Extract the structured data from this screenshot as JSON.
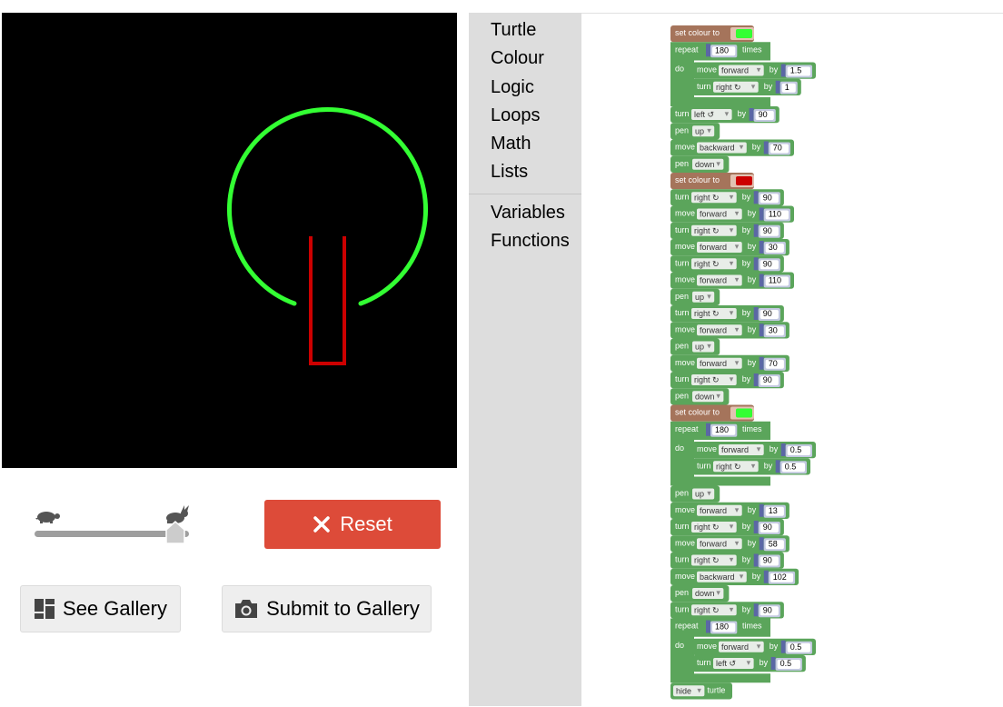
{
  "speed": {
    "slow_icon": "turtle-icon",
    "fast_icon": "rabbit-icon",
    "value": 1.0
  },
  "reset": {
    "icon": "close-icon",
    "label": "Reset"
  },
  "gallery": {
    "see_label": "See Gallery",
    "see_icon": "gallery-icon",
    "submit_label": "Submit to Gallery",
    "submit_icon": "camera-icon"
  },
  "toolbox": {
    "categories": [
      "Turtle",
      "Colour",
      "Logic",
      "Loops",
      "Math",
      "Lists"
    ],
    "categories2": [
      "Variables",
      "Functions"
    ]
  },
  "colors": {
    "turtle": "#5ba55b",
    "colour": "#a5745b",
    "loops": "#5ba55b",
    "math": "#5b67a5",
    "field": "#c3c9e0",
    "green": "#33ff33",
    "red": "#cc0000",
    "reset": "#dd4b39"
  },
  "program": [
    {
      "t": "colour",
      "swatch": "green"
    },
    {
      "t": "repeat",
      "n": "180",
      "body": [
        {
          "t": "move",
          "dir": "forward",
          "v": "1.5"
        },
        {
          "t": "turn",
          "dir": "right ↻",
          "v": "1"
        }
      ]
    },
    {
      "t": "turn",
      "dir": "left ↺",
      "v": "90"
    },
    {
      "t": "pen",
      "dir": "up"
    },
    {
      "t": "move",
      "dir": "backward",
      "v": "70"
    },
    {
      "t": "pen",
      "dir": "down"
    },
    {
      "t": "colour",
      "swatch": "red"
    },
    {
      "t": "turn",
      "dir": "right ↻",
      "v": "90"
    },
    {
      "t": "move",
      "dir": "forward",
      "v": "110"
    },
    {
      "t": "turn",
      "dir": "right ↻",
      "v": "90"
    },
    {
      "t": "move",
      "dir": "forward",
      "v": "30"
    },
    {
      "t": "turn",
      "dir": "right ↻",
      "v": "90"
    },
    {
      "t": "move",
      "dir": "forward",
      "v": "110"
    },
    {
      "t": "pen",
      "dir": "up"
    },
    {
      "t": "turn",
      "dir": "right ↻",
      "v": "90"
    },
    {
      "t": "move",
      "dir": "forward",
      "v": "30"
    },
    {
      "t": "pen",
      "dir": "up"
    },
    {
      "t": "move",
      "dir": "forward",
      "v": "70"
    },
    {
      "t": "turn",
      "dir": "right ↻",
      "v": "90"
    },
    {
      "t": "pen",
      "dir": "down"
    },
    {
      "t": "colour",
      "swatch": "green"
    },
    {
      "t": "repeat",
      "n": "180",
      "body": [
        {
          "t": "move",
          "dir": "forward",
          "v": "0.5"
        },
        {
          "t": "turn",
          "dir": "right ↻",
          "v": "0.5"
        }
      ]
    },
    {
      "t": "pen",
      "dir": "up"
    },
    {
      "t": "move",
      "dir": "forward",
      "v": "13"
    },
    {
      "t": "turn",
      "dir": "right ↻",
      "v": "90"
    },
    {
      "t": "move",
      "dir": "forward",
      "v": "58"
    },
    {
      "t": "turn",
      "dir": "right ↻",
      "v": "90"
    },
    {
      "t": "move",
      "dir": "backward",
      "v": "102"
    },
    {
      "t": "pen",
      "dir": "down"
    },
    {
      "t": "turn",
      "dir": "right ↻",
      "v": "90"
    },
    {
      "t": "repeat",
      "n": "180",
      "body": [
        {
          "t": "move",
          "dir": "forward",
          "v": "0.5"
        },
        {
          "t": "turn",
          "dir": "left ↺",
          "v": "0.5"
        }
      ]
    },
    {
      "t": "hide",
      "dir": "hide"
    }
  ],
  "labels": {
    "set_colour": "set colour to",
    "repeat": "repeat",
    "times": "times",
    "do": "do",
    "move": "move",
    "turn": "turn",
    "by": "by",
    "pen": "pen",
    "turtle": "turtle"
  }
}
